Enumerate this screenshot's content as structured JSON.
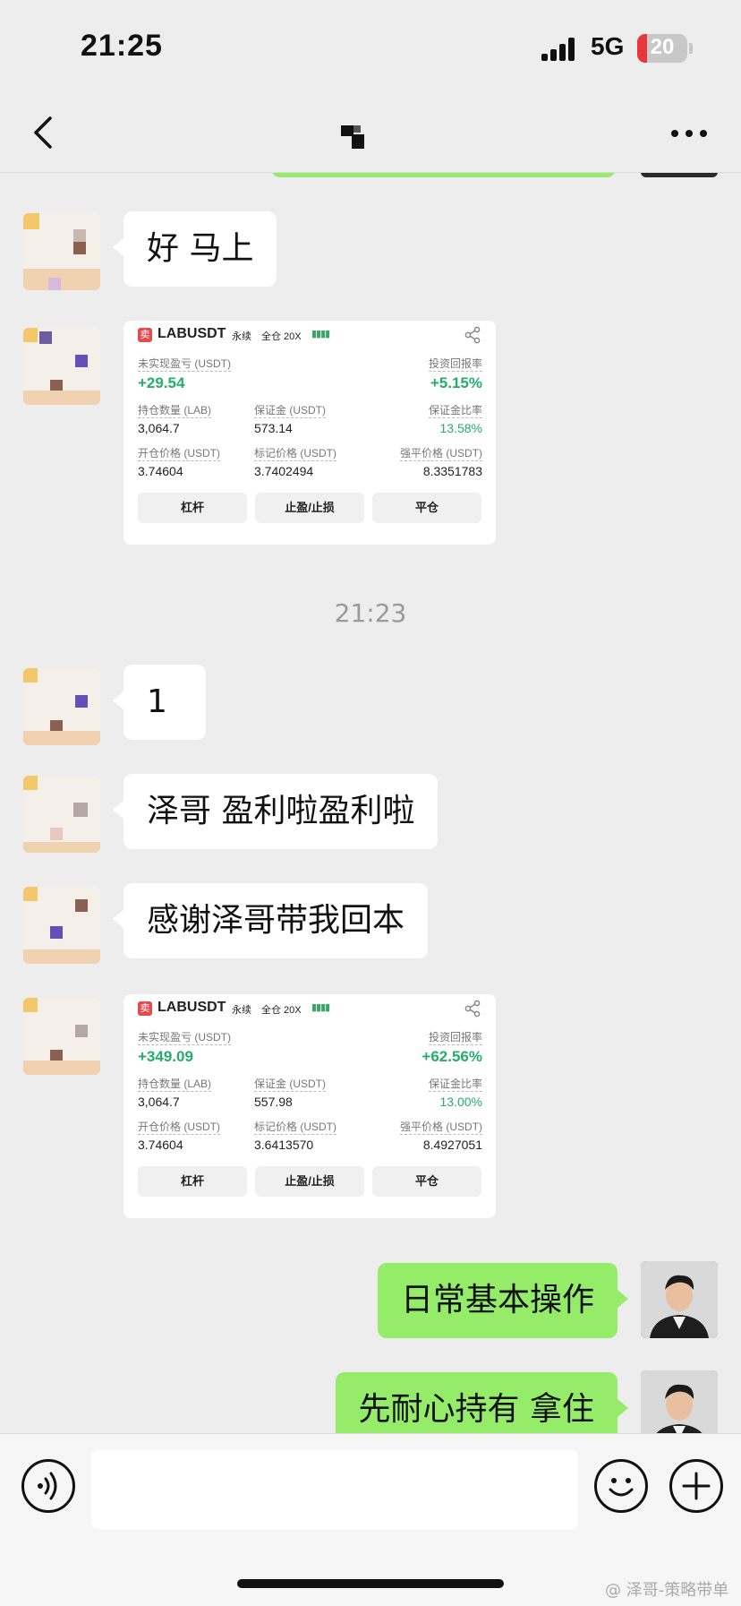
{
  "status": {
    "time": "21:25",
    "network": "5G",
    "battery": "20",
    "battery_level": 0.2
  },
  "nav": {
    "back": "back",
    "title_masked": true,
    "more": "more"
  },
  "timestamp": "21:23",
  "messages": {
    "m1": "好 马上",
    "m2": "1",
    "m3": "泽哥 盈利啦盈利啦",
    "m4": "感谢泽哥带我回本",
    "m5": "日常基本操作",
    "m6": "先耐心持有 拿住"
  },
  "card_labels": {
    "sell": "卖",
    "symbol": "LABUSDT",
    "perp": "永续",
    "margin_mode": "全仓 20X",
    "unrealized_pnl": "未实现盈亏 (USDT)",
    "roi": "投资回报率",
    "position_qty": "持仓数量 (LAB)",
    "margin": "保证金 (USDT)",
    "margin_ratio": "保证金比率",
    "entry_price": "开仓价格 (USDT)",
    "mark_price": "标记价格 (USDT)",
    "liq_price": "强平价格 (USDT)",
    "btn_leverage": "杠杆",
    "btn_tpsl": "止盈/止损",
    "btn_close": "平仓"
  },
  "cards": [
    {
      "pnl": "+29.54",
      "roi": "+5.15%",
      "qty": "3,064.7",
      "margin": "573.14",
      "margin_ratio": "13.58%",
      "entry": "3.74604",
      "mark": "3.7402494",
      "liq": "8.3351783"
    },
    {
      "pnl": "+349.09",
      "roi": "+62.56%",
      "qty": "3,064.7",
      "margin": "557.98",
      "margin_ratio": "13.00%",
      "entry": "3.74604",
      "mark": "3.6413570",
      "liq": "8.4927051"
    }
  ],
  "watermark": "@ 泽哥-策略带单",
  "colors": {
    "bg": "#ededed",
    "out_bubble": "#95ec69",
    "profit": "#24ad6d",
    "sell": "#e84a4a",
    "battery_low": "#e8363d"
  }
}
